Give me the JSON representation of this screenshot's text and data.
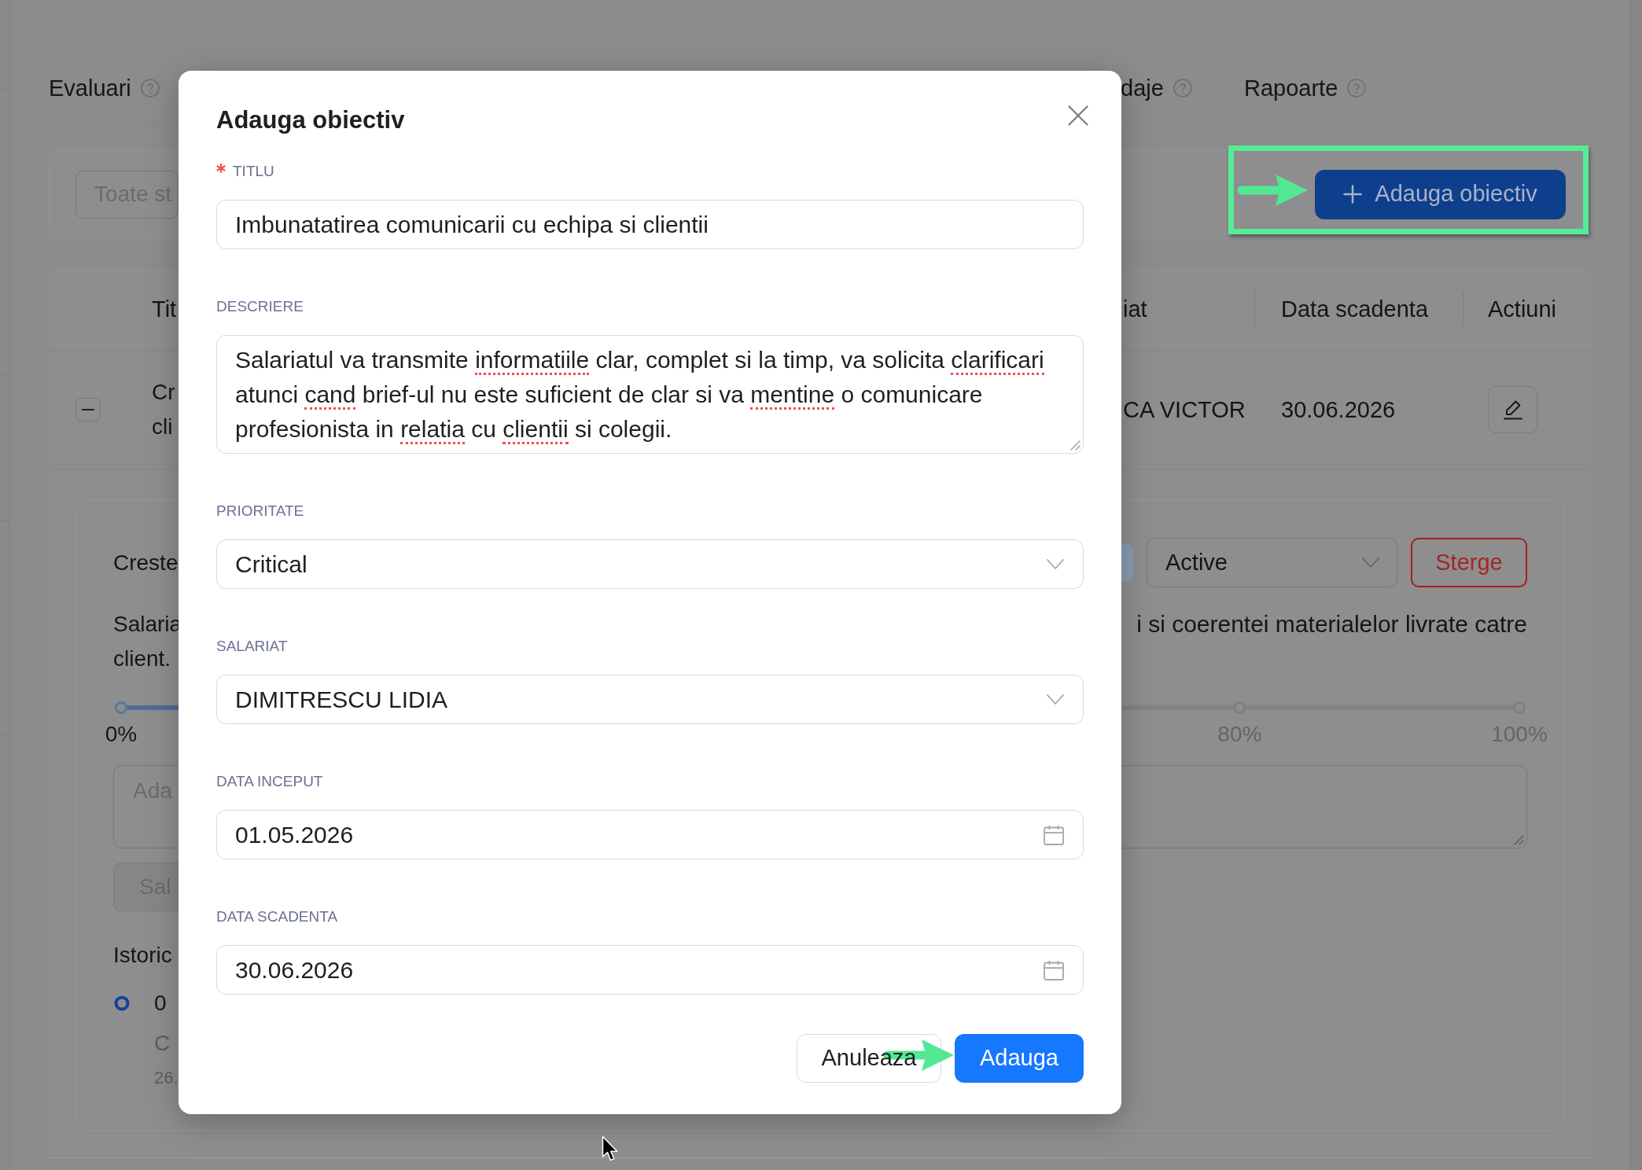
{
  "tabs": [
    {
      "label": "Evaluari",
      "selected": false
    },
    {
      "label": "daje",
      "selected": false
    },
    {
      "label": "Rapoarte",
      "selected": false
    }
  ],
  "filters": {
    "status_select": {
      "placeholder": "Toate st"
    }
  },
  "add_button": {
    "label": "Adauga obiectiv"
  },
  "table": {
    "columns": [
      "Tit",
      "iat",
      "Data scadenta",
      "Actiuni"
    ],
    "rows": [
      {
        "expanded": true,
        "title_lines": [
          "Cr",
          "cli"
        ],
        "employee": "CA VICTOR",
        "due_date": "30.06.2026",
        "detail": {
          "title": "Creste",
          "status_select": {
            "value": "Active"
          },
          "delete_button": {
            "label": "Sterge"
          },
          "description": {
            "line_1_left": "Salaria",
            "line_1_right": "i si coerentei materialelor livrate catre",
            "line_2_left": "client."
          },
          "progress": {
            "level": 0.4,
            "marks": [
              {
                "label": "0%"
              },
              {
                "label": "80%"
              },
              {
                "label": "100%"
              }
            ]
          },
          "comment_field": {
            "placeholder": "Ada"
          },
          "save_button": {
            "label": "Sal",
            "disabled": true
          },
          "history": {
            "title": "Istoric",
            "entries": [
              {
                "value": "0",
                "comment": "C",
                "date": "26."
              }
            ]
          }
        }
      }
    ]
  },
  "modal": {
    "title": "Adauga obiectiv",
    "fields": [
      {
        "kind": "text",
        "label": "TITLU",
        "required": true,
        "value": "Imbunatatirea comunicarii cu echipa si clientii"
      },
      {
        "kind": "textarea",
        "label": "DESCRIERE",
        "required": false,
        "lines": [
          [
            {
              "text": "Salariatul va transmite ",
              "misspelled": false
            },
            {
              "text": "informatiile",
              "misspelled": true
            },
            {
              "text": " clar, complet si la timp, va solicita ",
              "misspelled": false
            },
            {
              "text": "clarificari",
              "misspelled": true
            }
          ],
          [
            {
              "text": "atunci ",
              "misspelled": false
            },
            {
              "text": "cand",
              "misspelled": true
            },
            {
              "text": " brief-ul nu este suficient de clar si va ",
              "misspelled": false
            },
            {
              "text": "mentine",
              "misspelled": true
            },
            {
              "text": " o comunicare",
              "misspelled": false
            }
          ],
          [
            {
              "text": "profesionista in ",
              "misspelled": false
            },
            {
              "text": "relatia",
              "misspelled": true
            },
            {
              "text": " cu ",
              "misspelled": false
            },
            {
              "text": "clientii",
              "misspelled": true
            },
            {
              "text": " si colegii.",
              "misspelled": false
            }
          ]
        ]
      },
      {
        "kind": "select",
        "label": "PRIORITATE",
        "required": false,
        "value": "Critical"
      },
      {
        "kind": "select",
        "label": "SALARIAT",
        "required": false,
        "value": "DIMITRESCU LIDIA"
      },
      {
        "kind": "date",
        "label": "DATA INCEPUT",
        "required": false,
        "value": "01.05.2026"
      },
      {
        "kind": "date",
        "label": "DATA SCADENTA",
        "required": false,
        "value": "30.06.2026"
      }
    ],
    "buttons": [
      {
        "kind": "default",
        "label": "Anuleaza"
      },
      {
        "kind": "primary",
        "label": "Adauga"
      }
    ]
  }
}
